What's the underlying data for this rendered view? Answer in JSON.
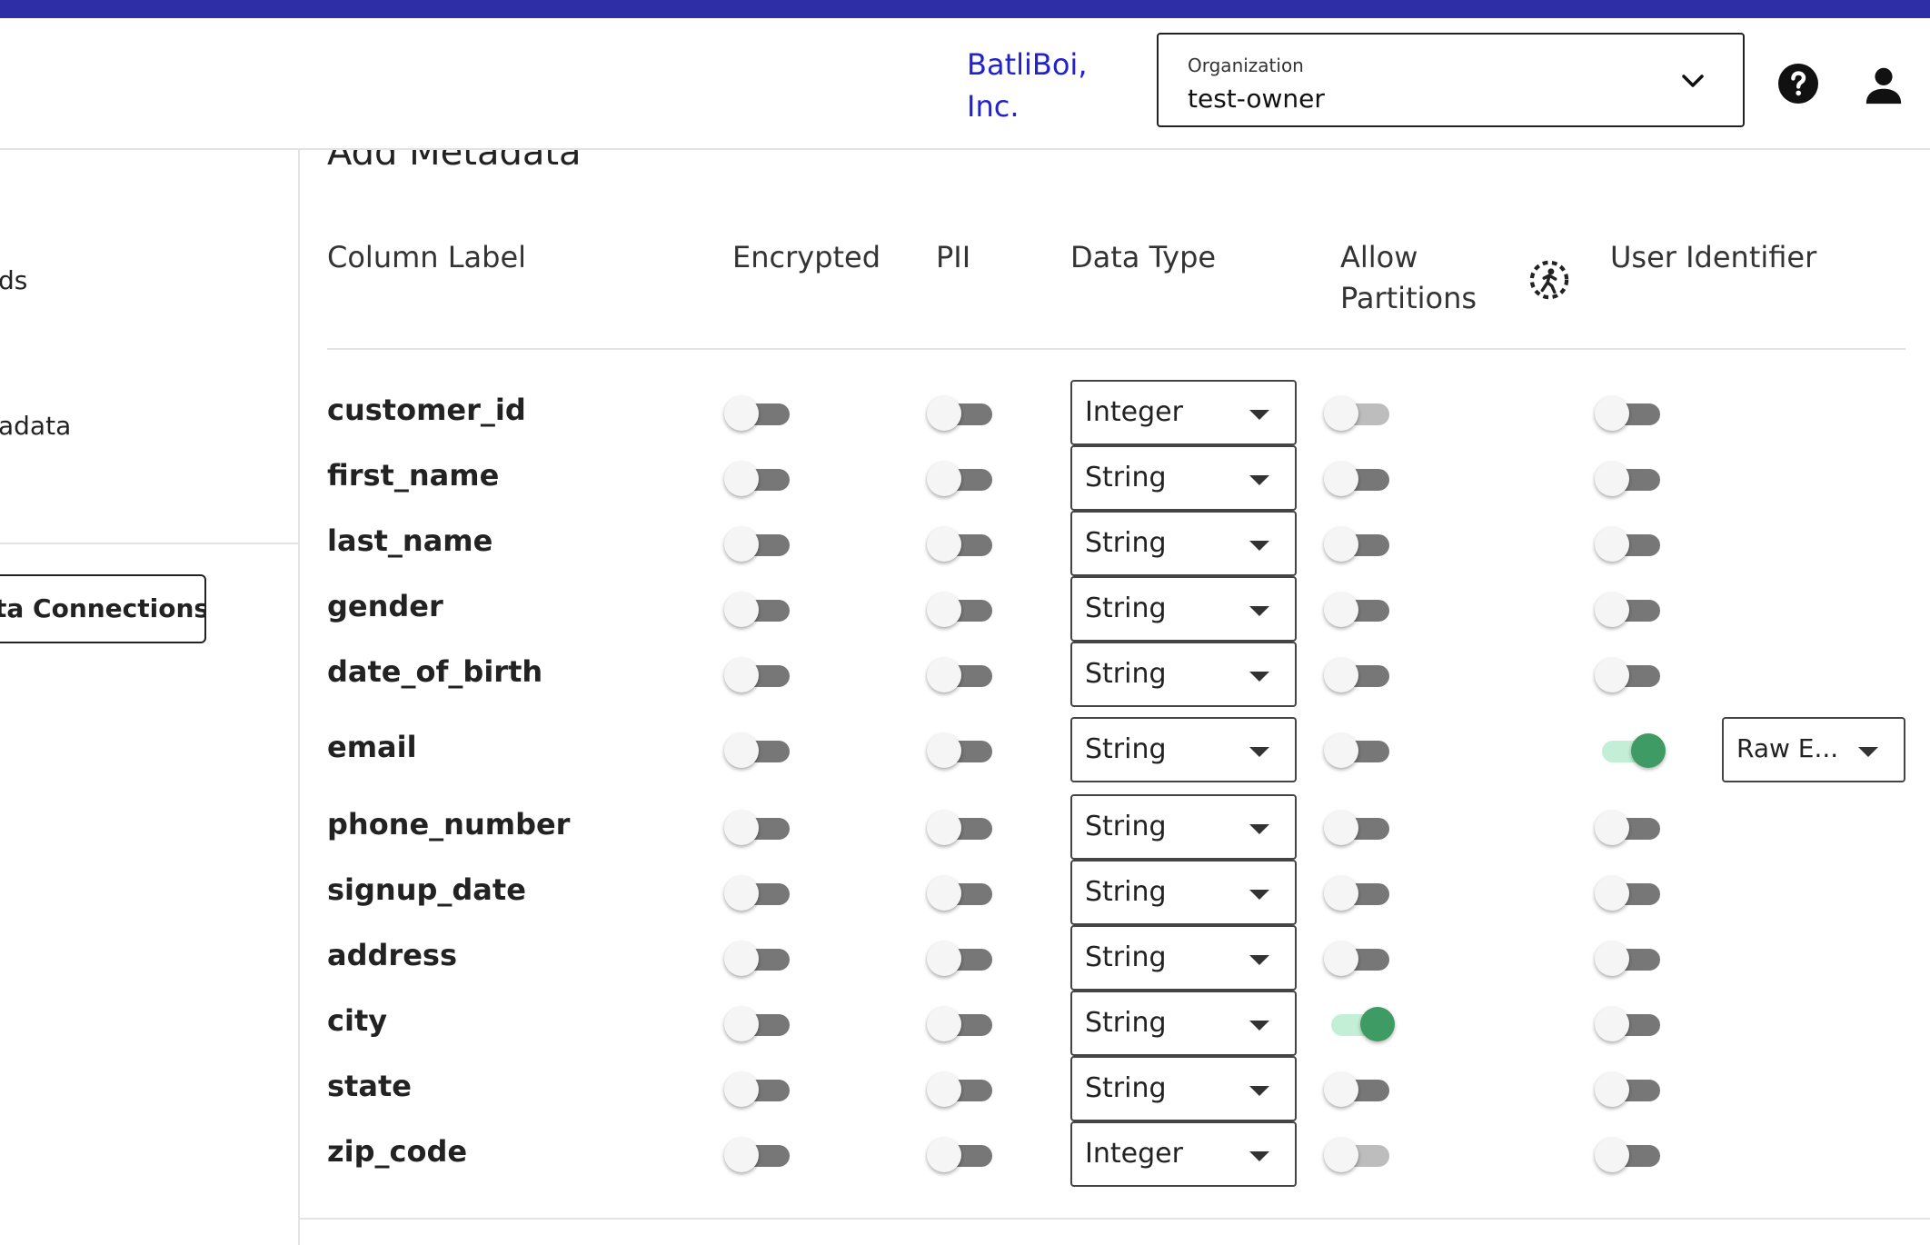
{
  "header": {
    "brand": "BatliBoi, Inc.",
    "organization_label": "Organization",
    "organization_value": "test-owner",
    "icons": [
      "chevron-down-icon",
      "help-icon",
      "user-icon"
    ],
    "bar_color": "#2e2ea6",
    "brand_color": "#2222cc"
  },
  "sidebar": {
    "items": [
      "ds",
      "adata"
    ],
    "button_label": "ta Connections"
  },
  "section": {
    "title": "Add Metadata"
  },
  "columns": {
    "label": "Column Label",
    "encrypted": "Encrypted",
    "pii": "PII",
    "data_type": "Data Type",
    "allow_partitions_1": "Allow",
    "allow_partitions_2": "Partitions",
    "user_identifier": "User Identifier"
  },
  "toggle_colors": {
    "on_knob": "#3e9b64",
    "on_track": "#c2efd5",
    "off_track": "#777777"
  },
  "rows": [
    {
      "label": "customer_id",
      "encrypted": false,
      "pii": false,
      "data_type": "Integer",
      "allow_partitions": false,
      "partitions_disabled": true,
      "user_identifier": false
    },
    {
      "label": "first_name",
      "encrypted": false,
      "pii": false,
      "data_type": "String",
      "allow_partitions": false,
      "partitions_disabled": false,
      "user_identifier": false
    },
    {
      "label": "last_name",
      "encrypted": false,
      "pii": false,
      "data_type": "String",
      "allow_partitions": false,
      "partitions_disabled": false,
      "user_identifier": false
    },
    {
      "label": "gender",
      "encrypted": false,
      "pii": false,
      "data_type": "String",
      "allow_partitions": false,
      "partitions_disabled": false,
      "user_identifier": false
    },
    {
      "label": "date_of_birth",
      "encrypted": false,
      "pii": false,
      "data_type": "String",
      "allow_partitions": false,
      "partitions_disabled": false,
      "user_identifier": false
    },
    {
      "label": "email",
      "encrypted": false,
      "pii": false,
      "data_type": "String",
      "allow_partitions": false,
      "partitions_disabled": false,
      "user_identifier": true,
      "identifier_type": "Raw E..."
    },
    {
      "label": "phone_number",
      "encrypted": false,
      "pii": false,
      "data_type": "String",
      "allow_partitions": false,
      "partitions_disabled": false,
      "user_identifier": false
    },
    {
      "label": "signup_date",
      "encrypted": false,
      "pii": false,
      "data_type": "String",
      "allow_partitions": false,
      "partitions_disabled": false,
      "user_identifier": false
    },
    {
      "label": "address",
      "encrypted": false,
      "pii": false,
      "data_type": "String",
      "allow_partitions": false,
      "partitions_disabled": false,
      "user_identifier": false
    },
    {
      "label": "city",
      "encrypted": false,
      "pii": false,
      "data_type": "String",
      "allow_partitions": true,
      "partitions_disabled": false,
      "user_identifier": false
    },
    {
      "label": "state",
      "encrypted": false,
      "pii": false,
      "data_type": "String",
      "allow_partitions": false,
      "partitions_disabled": false,
      "user_identifier": false
    },
    {
      "label": "zip_code",
      "encrypted": false,
      "pii": false,
      "data_type": "Integer",
      "allow_partitions": false,
      "partitions_disabled": true,
      "user_identifier": false
    }
  ]
}
